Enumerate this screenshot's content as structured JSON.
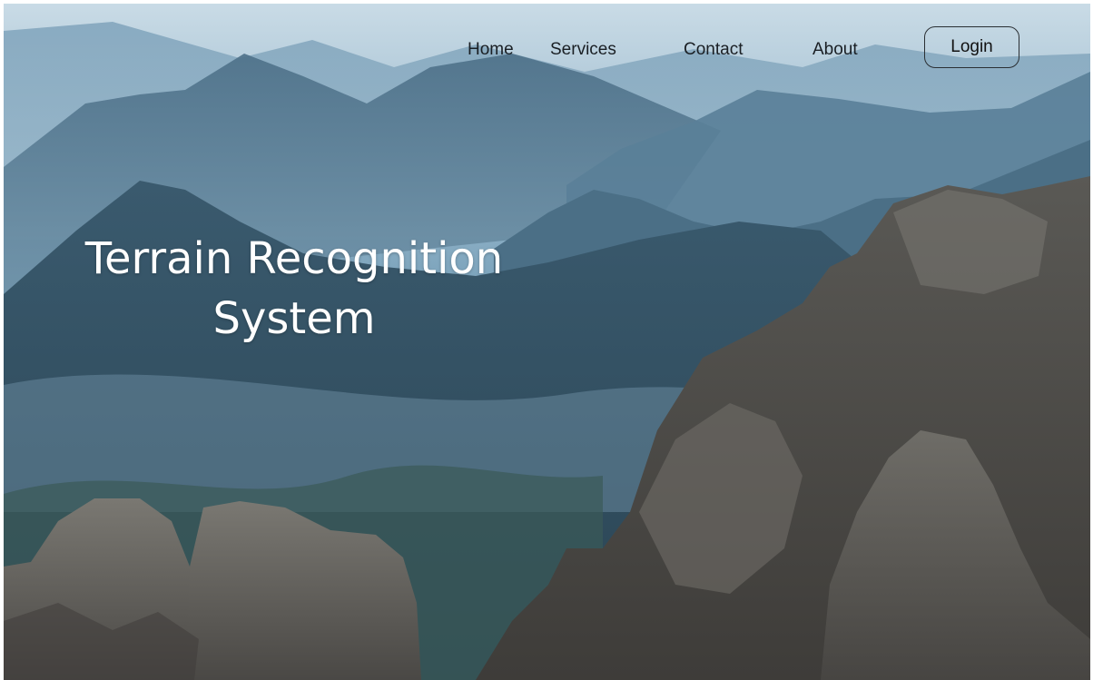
{
  "nav": {
    "links": [
      {
        "label": "Home"
      },
      {
        "label": "Services"
      },
      {
        "label": "Contact"
      },
      {
        "label": "About"
      }
    ],
    "login_label": "Login"
  },
  "hero": {
    "title_line1": "Terrain Recognition",
    "title_line2": "System"
  },
  "colors": {
    "sky": "#c9dbe6",
    "mist": "#7ea5bd",
    "far_ridge": "#5f86a0",
    "mid_ridge": "#3f6279",
    "near_ridge": "#2c4555",
    "rock": "#6b6a66",
    "title_text": "#ffffff"
  }
}
